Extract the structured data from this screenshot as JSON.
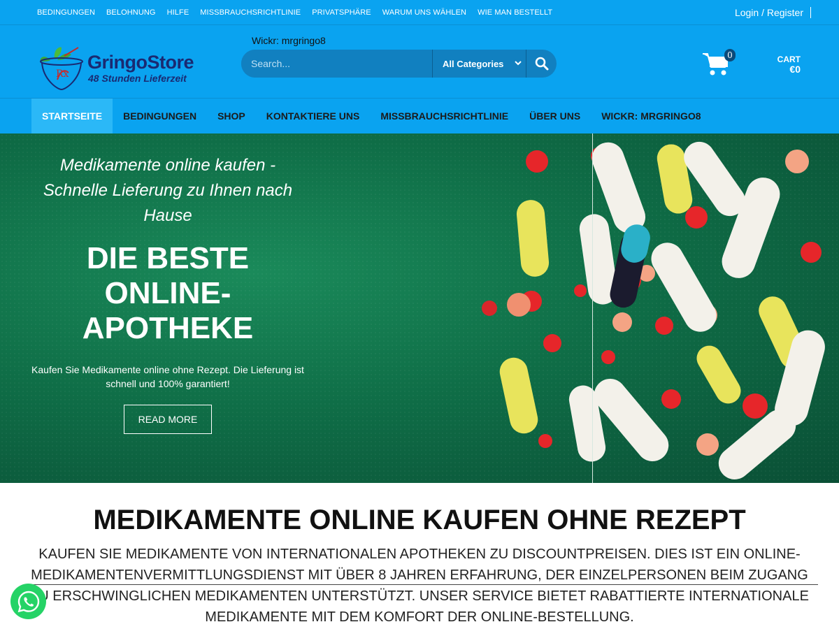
{
  "topbar": {
    "links": [
      "BEDINGUNGEN",
      "BELOHNUNG",
      "HILFE",
      "MISSBRAUCHSRICHTLINIE",
      "PRIVATSPHÄRE",
      "WARUM UNS WÄHLEN",
      "WIE MAN BESTELLT"
    ],
    "login": "Login / Register"
  },
  "header": {
    "logo_name": "GringoStore",
    "logo_tagline": "48 Stunden Lieferzeit",
    "logo_rx": "Rx",
    "wickr": "Wickr: mrgringo8",
    "search_placeholder": "Search...",
    "category": "All Categories",
    "cart_count": "0",
    "cart_label": "CART",
    "cart_total": "€0"
  },
  "nav": {
    "items": [
      "STARTSEITE",
      "BEDINGUNGEN",
      "SHOP",
      "KONTAKTIERE UNS",
      "MISSBRAUCHSRICHTLINIE",
      "ÜBER UNS",
      "WICKR: MRGRINGO8"
    ],
    "active": "STARTSEITE"
  },
  "hero": {
    "subtitle": "Medikamente online kaufen - Schnelle Lieferung zu Ihnen nach Hause",
    "title": "DIE BESTE ONLINE-APOTHEKE",
    "description": "Kaufen Sie Medikamente online ohne Rezept. Die Lieferung ist schnell und 100% garantiert!",
    "button": "READ MORE"
  },
  "section": {
    "title": "MEDIKAMENTE ONLINE KAUFEN OHNE REZEPT",
    "text": "KAUFEN SIE MEDIKAMENTE VON INTERNATIONALEN APOTHEKEN ZU DISCOUNTPREISEN. DIES IST EIN ONLINE-MEDIKAMENTENVERMITTLUNGSDIENST MIT ÜBER 8 JAHREN ERFAHRUNG, DER EINZELPERSONEN BEIM ZUGANG ZU ERSCHWINGLICHEN MEDIKAMENTEN UNTERSTÜTZT. UNSER SERVICE BIETET RABATTIERTE INTERNATIONALE MEDIKAMENTE MIT DEM KOMFORT DER ONLINE-BESTELLUNG."
  },
  "colors": {
    "brand_blue": "#0aa3f0",
    "search_blue": "#1180c0",
    "hero_green": "#0f6e47",
    "whatsapp_green": "#25d366"
  },
  "icons": [
    "search-icon",
    "cart-icon",
    "chevron-down-icon",
    "whatsapp-icon",
    "logo-icon"
  ]
}
